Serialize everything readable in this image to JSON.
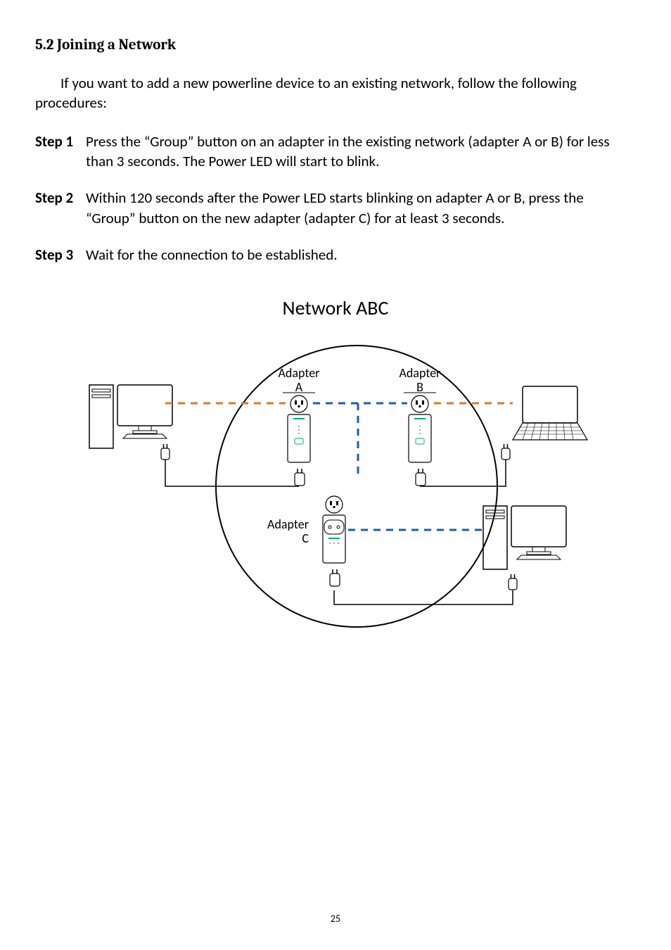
{
  "heading": "5.2 Joining a Network",
  "intro": "If you want to add a new powerline device to an existing network, follow the following procedures:",
  "steps": [
    {
      "label": "Step 1",
      "text": "Press the “Group” button on an adapter in the existing network (adapter A or B) for less than 3 seconds. The Power LED will start to blink."
    },
    {
      "label": "Step 2",
      "text": "Within 120 seconds after the Power LED starts blinking on adapter A or B, press the “Group” button on the new adapter (adapter C) for at least 3 seconds."
    },
    {
      "label": "Step 3",
      "text": "Wait for the connection to be established."
    }
  ],
  "diagram": {
    "title": "Network ABC",
    "labels": {
      "adapterA": "Adapter\nA",
      "adapterB": "Adapter\nB",
      "adapterC": "Adapter\nC"
    }
  },
  "page_number": "25"
}
